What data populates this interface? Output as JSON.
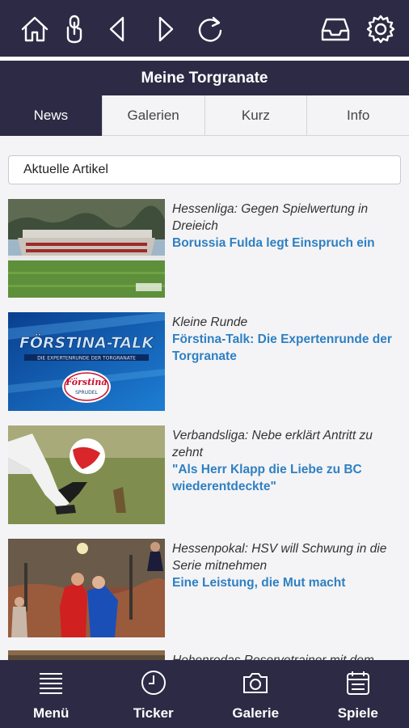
{
  "toolbar": {
    "icons": [
      "home-icon",
      "touch-icon",
      "back-icon",
      "forward-icon",
      "reload-icon",
      "inbox-icon",
      "settings-icon"
    ]
  },
  "header": {
    "title": "Meine Torgranate"
  },
  "tabs": [
    {
      "label": "News",
      "active": true
    },
    {
      "label": "Galerien",
      "active": false
    },
    {
      "label": "Kurz",
      "active": false
    },
    {
      "label": "Info",
      "active": false
    }
  ],
  "filter": {
    "selected": "Aktuelle Artikel"
  },
  "articles": [
    {
      "kicker": "Hessenliga: Gegen Spielwertung in Dreieich",
      "headline": "Borussia Fulda legt Einspruch ein"
    },
    {
      "kicker": "Kleine Runde",
      "headline": "Förstina-Talk: Die Expertenrunde der Torgranate"
    },
    {
      "kicker": "Verbandsliga: Nebe erklärt Antritt zu zehnt",
      "headline": "\"Als Herr Klapp die Liebe zu BC wiederentdeckte\""
    },
    {
      "kicker": "Hessenpokal: HSV will Schwung in die Serie mitnehmen",
      "headline": "Eine Leistung, die Mut macht"
    },
    {
      "kicker": "Hohenrodas Reservetrainer mit dem",
      "headline": ""
    }
  ],
  "thumb_text": {
    "talk_title": "FÖRSTINA-TALK",
    "talk_sub": "DIE EXPERTENRUNDE DER TORGRANATE",
    "brand_1": "Förstina",
    "brand_2": "SPRUDEL"
  },
  "bottom_nav": [
    {
      "label": "Menü",
      "icon": "menu-icon"
    },
    {
      "label": "Ticker",
      "icon": "clock-icon"
    },
    {
      "label": "Galerie",
      "icon": "camera-icon"
    },
    {
      "label": "Spiele",
      "icon": "calendar-icon"
    }
  ],
  "colors": {
    "bar": "#2d2a45",
    "headline": "#2f80c2",
    "background": "#f4f4f6"
  }
}
